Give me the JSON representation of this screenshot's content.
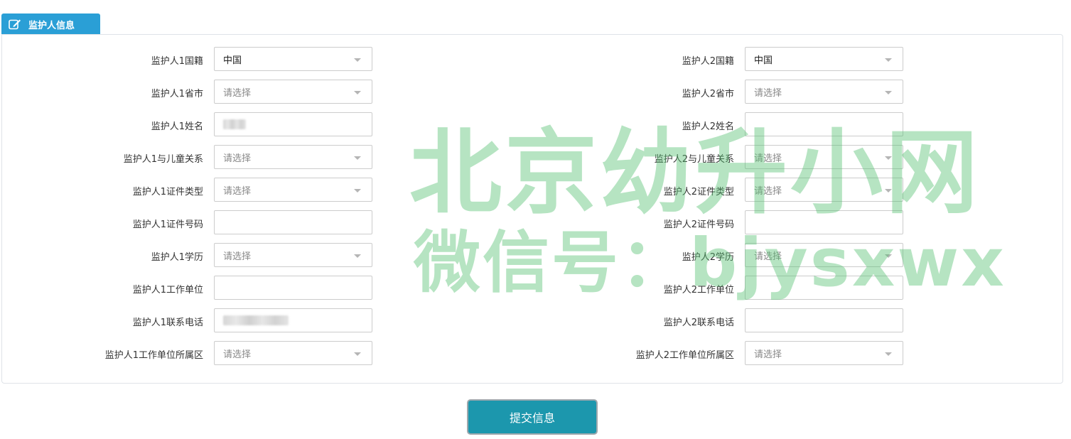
{
  "section": {
    "title": "监护人信息",
    "icon": "edit-icon"
  },
  "guardian1": {
    "nationality": {
      "label": "监护人1国籍",
      "value": "中国"
    },
    "province": {
      "label": "监护人1省市",
      "placeholder": "请选择"
    },
    "name": {
      "label": "监护人1姓名",
      "value": ""
    },
    "relation": {
      "label": "监护人1与儿童关系",
      "placeholder": "请选择"
    },
    "id_type": {
      "label": "监护人1证件类型",
      "placeholder": "请选择"
    },
    "id_number": {
      "label": "监护人1证件号码",
      "value": ""
    },
    "education": {
      "label": "监护人1学历",
      "placeholder": "请选择"
    },
    "employer": {
      "label": "监护人1工作单位",
      "value": ""
    },
    "phone": {
      "label": "监护人1联系电话",
      "value": ""
    },
    "employer_district": {
      "label": "监护人1工作单位所属区",
      "placeholder": "请选择"
    }
  },
  "guardian2": {
    "nationality": {
      "label": "监护人2国籍",
      "value": "中国"
    },
    "province": {
      "label": "监护人2省市",
      "placeholder": "请选择"
    },
    "name": {
      "label": "监护人2姓名",
      "value": ""
    },
    "relation": {
      "label": "监护人2与儿童关系",
      "placeholder": "请选择"
    },
    "id_type": {
      "label": "监护人2证件类型",
      "placeholder": "请选择"
    },
    "id_number": {
      "label": "监护人2证件号码",
      "value": ""
    },
    "education": {
      "label": "监护人2学历",
      "placeholder": "请选择"
    },
    "employer": {
      "label": "监护人2工作单位",
      "value": ""
    },
    "phone": {
      "label": "监护人2联系电话",
      "value": ""
    },
    "employer_district": {
      "label": "监护人2工作单位所属区",
      "placeholder": "请选择"
    }
  },
  "submit_label": "提交信息",
  "watermark": {
    "line1": "北京幼升小网",
    "line2": "微信号：bjysxwx"
  },
  "colors": {
    "tab_bg": "#2a9fd6",
    "submit_bg": "#1c97ad",
    "watermark": "#50be6e"
  }
}
